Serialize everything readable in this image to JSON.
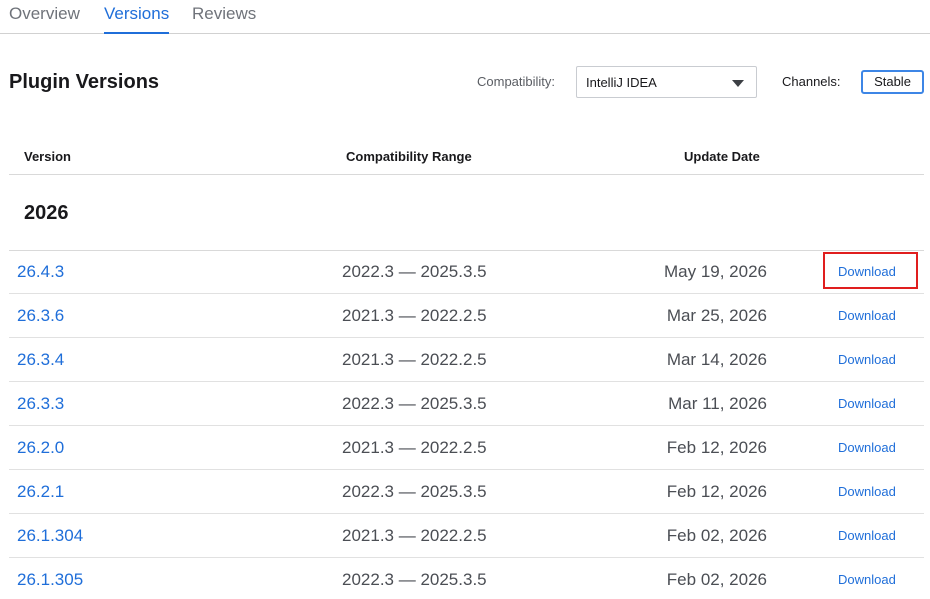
{
  "tabs": [
    {
      "label": "Overview"
    },
    {
      "label": "Versions"
    },
    {
      "label": "Reviews"
    }
  ],
  "header": {
    "title": "Plugin Versions",
    "compatibility_label": "Compatibility:",
    "compatibility_value": "IntelliJ IDEA",
    "channels_label": "Channels:",
    "channel_button": "Stable"
  },
  "table": {
    "columns": [
      "Version",
      "Compatibility Range",
      "Update Date"
    ],
    "year": "2026",
    "rows": [
      {
        "version": "26.4.3",
        "range": "2022.3 — 2025.3.5",
        "date": "May 19, 2026",
        "action": "Download"
      },
      {
        "version": "26.3.6",
        "range": "2021.3 — 2022.2.5",
        "date": "Mar 25, 2026",
        "action": "Download"
      },
      {
        "version": "26.3.4",
        "range": "2021.3 — 2022.2.5",
        "date": "Mar 14, 2026",
        "action": "Download"
      },
      {
        "version": "26.3.3",
        "range": "2022.3 — 2025.3.5",
        "date": "Mar 11, 2026",
        "action": "Download"
      },
      {
        "version": "26.2.0",
        "range": "2021.3 — 2022.2.5",
        "date": "Feb 12, 2026",
        "action": "Download"
      },
      {
        "version": "26.2.1",
        "range": "2022.3 — 2025.3.5",
        "date": "Feb 12, 2026",
        "action": "Download"
      },
      {
        "version": "26.1.304",
        "range": "2021.3 — 2022.2.5",
        "date": "Feb 02, 2026",
        "action": "Download"
      },
      {
        "version": "26.1.305",
        "range": "2022.3 — 2025.3.5",
        "date": "Feb 02, 2026",
        "action": "Download"
      }
    ]
  },
  "colors": {
    "accent": "#1f6ed9",
    "highlight": "#e01e1e"
  },
  "icons": {
    "compat_dropdown": "chevron-down-icon"
  }
}
